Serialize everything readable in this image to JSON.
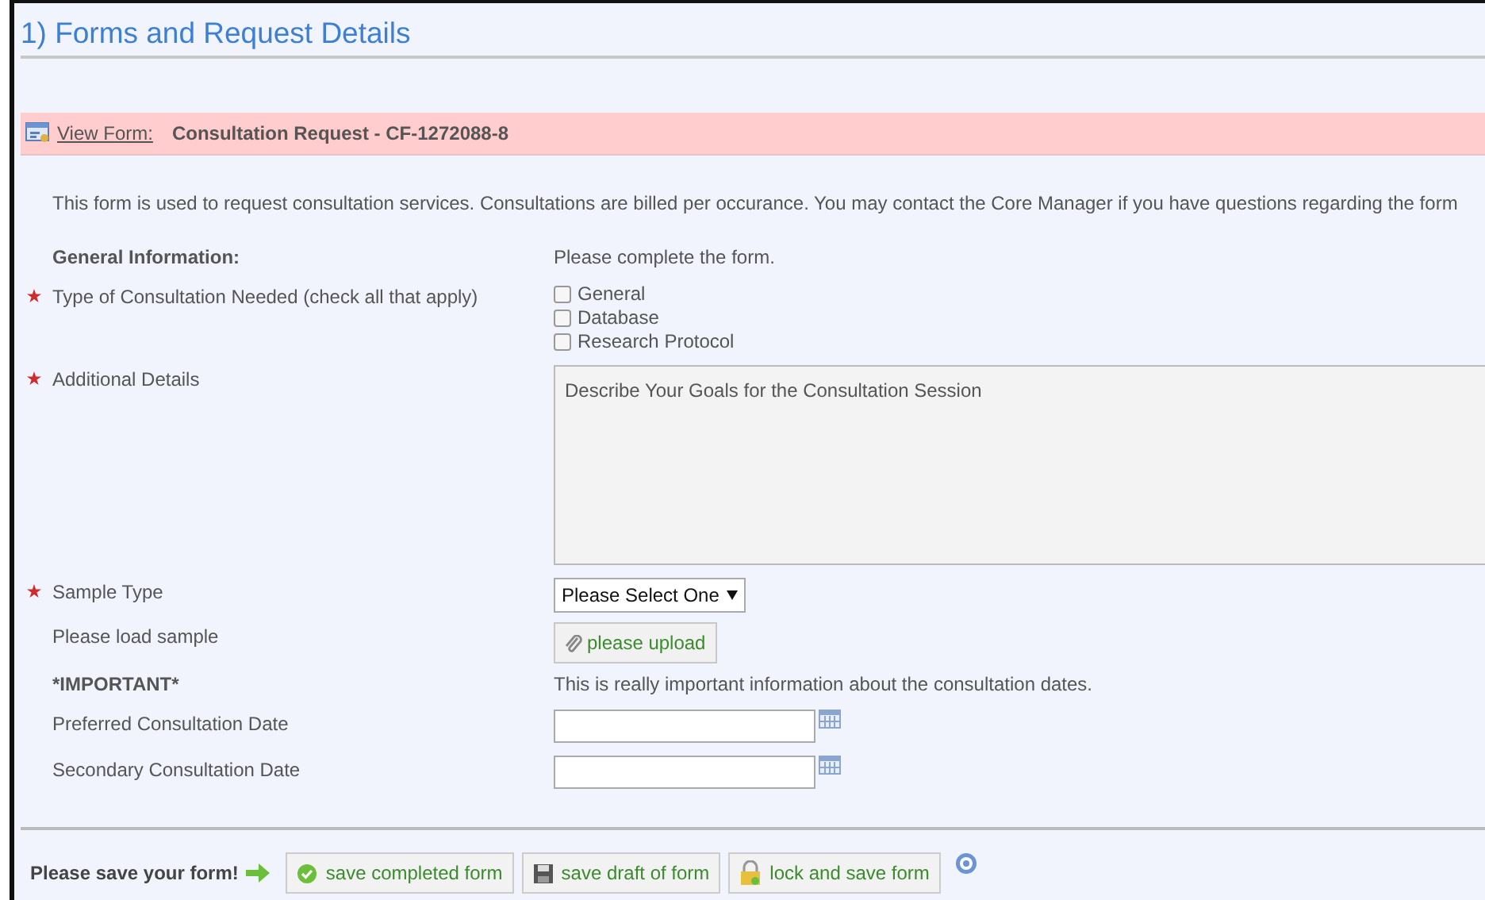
{
  "section_title": "1) Forms and Request Details",
  "form_bar": {
    "link": "View Form:",
    "title": "Consultation Request - CF-1272088-8"
  },
  "description": "This form is used to request consultation services.  Consultations are billed per occurance.  You may contact the Core Manager if you have questions regarding the form",
  "fields": [
    {
      "kind": "heading",
      "label": "General Information:",
      "required": false,
      "text": "Please complete the form."
    },
    {
      "kind": "checkboxes",
      "label": "Type of Consultation Needed (check all that apply)",
      "required": true,
      "options": [
        {
          "label": "General",
          "checked": false
        },
        {
          "label": "Database",
          "checked": false
        },
        {
          "label": "Research Protocol",
          "checked": false
        }
      ]
    },
    {
      "kind": "textarea",
      "label": "Additional Details",
      "required": true,
      "value": "Describe Your Goals for the Consultation Session"
    },
    {
      "kind": "select",
      "label": "Sample Type",
      "required": true,
      "value": "Please Select One"
    },
    {
      "kind": "upload",
      "label": "Please load sample",
      "required": false,
      "button": "please upload"
    },
    {
      "kind": "heading",
      "label": "*IMPORTANT*",
      "required": false,
      "text": "This is really important information about the consultation dates."
    },
    {
      "kind": "date",
      "label": "Preferred Consultation Date",
      "required": false
    },
    {
      "kind": "date",
      "label": "Secondary Consultation Date",
      "required": false
    }
  ],
  "footer": {
    "prompt": "Please save your form!",
    "buttons": [
      {
        "kind": "complete",
        "label": "save completed form"
      },
      {
        "kind": "draft",
        "label": "save draft of form"
      },
      {
        "kind": "lock",
        "label": "lock and save form"
      }
    ]
  }
}
